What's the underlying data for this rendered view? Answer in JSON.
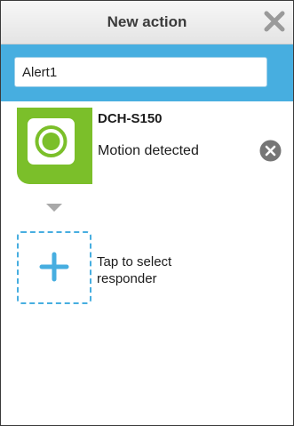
{
  "header": {
    "title": "New action",
    "close_icon": "close-icon"
  },
  "action": {
    "name_value": "Alert1"
  },
  "trigger": {
    "device_name": "DCH-S150",
    "event": "Motion detected",
    "icon": "motion-sensor-icon",
    "remove_icon": "remove-circle-icon"
  },
  "responder": {
    "label": "Tap to select responder",
    "icon": "plus-icon"
  },
  "colors": {
    "accent": "#47aee0",
    "trigger": "#7bbf2a",
    "header_text": "#3b3b3b"
  }
}
